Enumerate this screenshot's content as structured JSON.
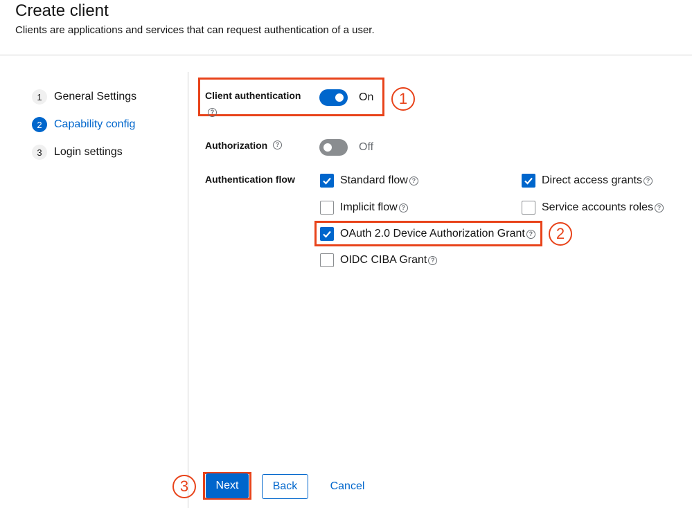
{
  "header": {
    "title": "Create client",
    "description": "Clients are applications and services that can request authentication of a user."
  },
  "wizard": {
    "steps": [
      {
        "number": "1",
        "label": "General Settings"
      },
      {
        "number": "2",
        "label": "Capability config"
      },
      {
        "number": "3",
        "label": "Login settings"
      }
    ],
    "current_step": 2
  },
  "form": {
    "client_authentication": {
      "label": "Client authentication",
      "state": "On",
      "enabled": true
    },
    "authorization": {
      "label": "Authorization",
      "state": "Off",
      "enabled": false
    },
    "authentication_flow": {
      "label": "Authentication flow",
      "options": [
        {
          "label": "Standard flow",
          "checked": true
        },
        {
          "label": "Direct access grants",
          "checked": true
        },
        {
          "label": "Implicit flow",
          "checked": false
        },
        {
          "label": "Service accounts roles",
          "checked": false
        },
        {
          "label": "OAuth 2.0 Device Authorization Grant",
          "checked": true
        },
        {
          "label": "OIDC CIBA Grant",
          "checked": false
        }
      ]
    },
    "help_glyph": "?"
  },
  "annotations": {
    "one": "1",
    "two": "2",
    "three": "3",
    "color": "#e8431a"
  },
  "footer": {
    "next_label": "Next",
    "back_label": "Back",
    "cancel_label": "Cancel"
  },
  "colors": {
    "primary": "#0066cc",
    "highlight": "#e8431a",
    "off_switch": "#8a8d90"
  }
}
